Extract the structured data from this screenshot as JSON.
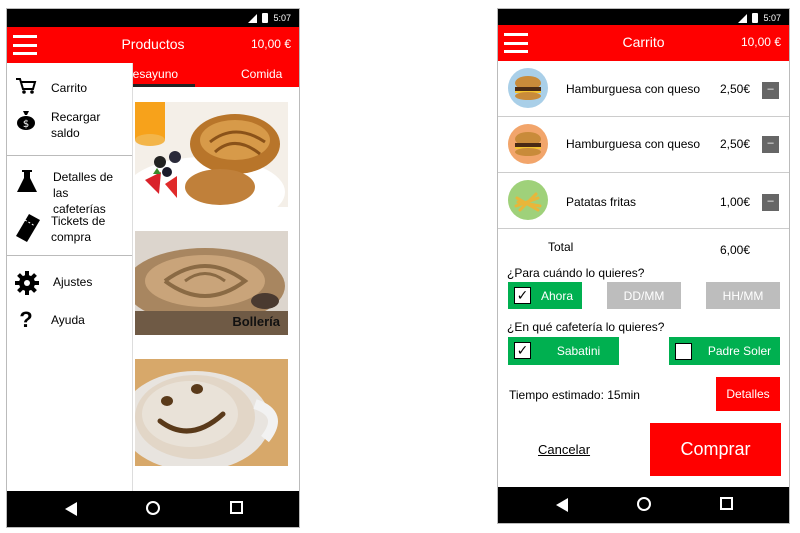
{
  "status": {
    "time": "5:07"
  },
  "left": {
    "app_title": "Productos",
    "price": "10,00 €",
    "tabs": [
      {
        "label": "Desayuno"
      },
      {
        "label": "Comida"
      }
    ],
    "images": [
      {
        "label": ""
      },
      {
        "label": "Bollería"
      },
      {
        "label": ""
      }
    ],
    "drawer": {
      "items": [
        {
          "label": "Carrito",
          "icon": "cart-icon"
        },
        {
          "label": "Recargar saldo",
          "icon": "money-bag-icon"
        },
        {
          "label": "Detalles de las cafeterías",
          "icon": "flask-icon"
        },
        {
          "label": "Tickets de compra",
          "icon": "ticket-icon"
        },
        {
          "label": "Ajustes",
          "icon": "gear-icon"
        },
        {
          "label": "Ayuda",
          "icon": "help-icon"
        }
      ]
    }
  },
  "right": {
    "app_title": "Carrito",
    "price": "10,00 €",
    "items": [
      {
        "name": "Hamburguesa con queso",
        "price": "2,50€",
        "remove": "–"
      },
      {
        "name": "Hamburguesa con queso",
        "price": "2,50€",
        "remove": "–"
      },
      {
        "name": "Patatas fritas",
        "price": "1,00€",
        "remove": "–"
      }
    ],
    "total_label": "Total",
    "total_value": "6,00€",
    "when_question": "¿Para cuándo lo quieres?",
    "when_options": {
      "now": "Ahora",
      "date": "DD/MM",
      "time": "HH/MM"
    },
    "where_question": "¿En qué cafetería lo quieres?",
    "where_options": {
      "first": "Sabatini",
      "second": "Padre Soler"
    },
    "estimate": "Tiempo estimado: 15min",
    "details_button": "Detalles",
    "cancel": "Cancelar",
    "buy": "Comprar"
  },
  "colors": {
    "primary": "#ff0000",
    "selected": "#00b050",
    "disabled": "#bdbdbd"
  }
}
